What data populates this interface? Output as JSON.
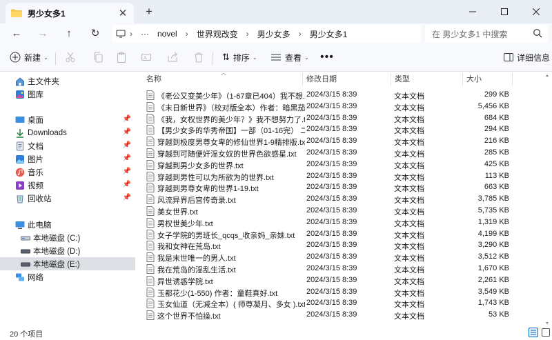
{
  "window": {
    "tab_title": "男少女多1",
    "tab_icon": "folder-icon",
    "controls": [
      "minimize-icon",
      "maximize-icon",
      "close-icon"
    ]
  },
  "address": {
    "path": [
      "novel",
      "世界观改变",
      "男少女多",
      "男少女多1"
    ],
    "search_placeholder": "在 男少女多1 中搜索"
  },
  "toolbar": {
    "new_label": "新建",
    "sort_label": "排序",
    "view_label": "查看",
    "details_label": "详细信息"
  },
  "sidebar": {
    "items": [
      {
        "label": "主文件夹",
        "icon": "home-icon"
      },
      {
        "label": "图库",
        "icon": "gallery-icon"
      },
      {
        "label": "桌面",
        "icon": "desktop-icon",
        "pinned": true
      },
      {
        "label": "Downloads",
        "icon": "download-icon",
        "pinned": true
      },
      {
        "label": "文档",
        "icon": "documents-icon",
        "pinned": true
      },
      {
        "label": "图片",
        "icon": "pictures-icon",
        "pinned": true
      },
      {
        "label": "音乐",
        "icon": "music-icon",
        "pinned": true
      },
      {
        "label": "视频",
        "icon": "videos-icon",
        "pinned": true
      },
      {
        "label": "回收站",
        "icon": "recycle-bin-icon",
        "pinned": true
      },
      {
        "label": "此电脑",
        "icon": "this-pc-icon"
      },
      {
        "label": "本地磁盘 (C:)",
        "icon": "drive-icon"
      },
      {
        "label": "本地磁盘 (D:)",
        "icon": "drive-icon"
      },
      {
        "label": "本地磁盘 (E:)",
        "icon": "drive-icon",
        "selected": true
      },
      {
        "label": "网络",
        "icon": "network-icon"
      }
    ]
  },
  "columns": {
    "name": "名称",
    "date": "修改日期",
    "type": "类型",
    "size": "大小"
  },
  "files": [
    {
      "name": "《老公又变美少年》（1-67章已404）我不想...",
      "date": "2024/3/15 8:39",
      "type": "文本文档",
      "size": "299 KB"
    },
    {
      "name": "《末日新世界》（校对版全本）作者：暗黑茄子...",
      "date": "2024/3/15 8:39",
      "type": "文本文档",
      "size": "5,456 KB"
    },
    {
      "name": "《我，女权世界的美少年？》我不想努力了.txt",
      "date": "2024/3/15 8:39",
      "type": "文本文档",
      "size": "684 KB"
    },
    {
      "name": "【男少女多的华秀帝国】一部（01-16完） 二...",
      "date": "2024/3/15 8:39",
      "type": "文本文档",
      "size": "294 KB"
    },
    {
      "name": "穿越到极度男尊女卑的修仙世界1-9精排版.txt",
      "date": "2024/3/15 8:39",
      "type": "文本文档",
      "size": "216 KB"
    },
    {
      "name": "穿越到可随便奸淫女奴的世界色欲感星.txt",
      "date": "2024/3/15 8:39",
      "type": "文本文档",
      "size": "285 KB"
    },
    {
      "name": "穿越到男少女多的世界.txt",
      "date": "2024/3/15 8:39",
      "type": "文本文档",
      "size": "425 KB"
    },
    {
      "name": "穿越到男性可以为所欲为的世界.txt",
      "date": "2024/3/15 8:39",
      "type": "文本文档",
      "size": "113 KB"
    },
    {
      "name": "穿越到男尊女卑的世界1-19.txt",
      "date": "2024/3/15 8:39",
      "type": "文本文档",
      "size": "663 KB"
    },
    {
      "name": "风流异界后宫传奇录.txt",
      "date": "2024/3/15 8:39",
      "type": "文本文档",
      "size": "3,785 KB"
    },
    {
      "name": "美女世界.txt",
      "date": "2024/3/15 8:39",
      "type": "文本文档",
      "size": "5,735 KB"
    },
    {
      "name": "男权世美少年.txt",
      "date": "2024/3/15 8:39",
      "type": "文本文档",
      "size": "1,319 KB"
    },
    {
      "name": "女子学院的男班长_qcqs_收亲妈_亲妹.txt",
      "date": "2024/3/15 8:39",
      "type": "文本文档",
      "size": "4,199 KB"
    },
    {
      "name": "我和女神在荒岛.txt",
      "date": "2024/3/15 8:39",
      "type": "文本文档",
      "size": "3,290 KB"
    },
    {
      "name": "我是末世唯一的男人.txt",
      "date": "2024/3/15 8:39",
      "type": "文本文档",
      "size": "3,512 KB"
    },
    {
      "name": "我在荒岛的淫乱生活.txt",
      "date": "2024/3/15 8:39",
      "type": "文本文档",
      "size": "1,670 KB"
    },
    {
      "name": "异世诱惑学院.txt",
      "date": "2024/3/15 8:39",
      "type": "文本文档",
      "size": "2,261 KB"
    },
    {
      "name": "玉都花少(1-550) 作者：童鞋真好.txt",
      "date": "2024/3/15 8:39",
      "type": "文本文档",
      "size": "3,549 KB"
    },
    {
      "name": "玉女仙道（无减全本）( 师尊凝月、多女 ).txt",
      "date": "2024/3/15 8:39",
      "type": "文本文档",
      "size": "1,743 KB"
    },
    {
      "name": "这个世界不怕操.txt",
      "date": "2024/3/15 8:39",
      "type": "文本文档",
      "size": "53 KB"
    }
  ],
  "status": {
    "item_count": "20 个项目"
  },
  "colors": {
    "accent": "#0067c0",
    "folder": "#f4c542",
    "selected_bg": "#dcdfe4"
  }
}
